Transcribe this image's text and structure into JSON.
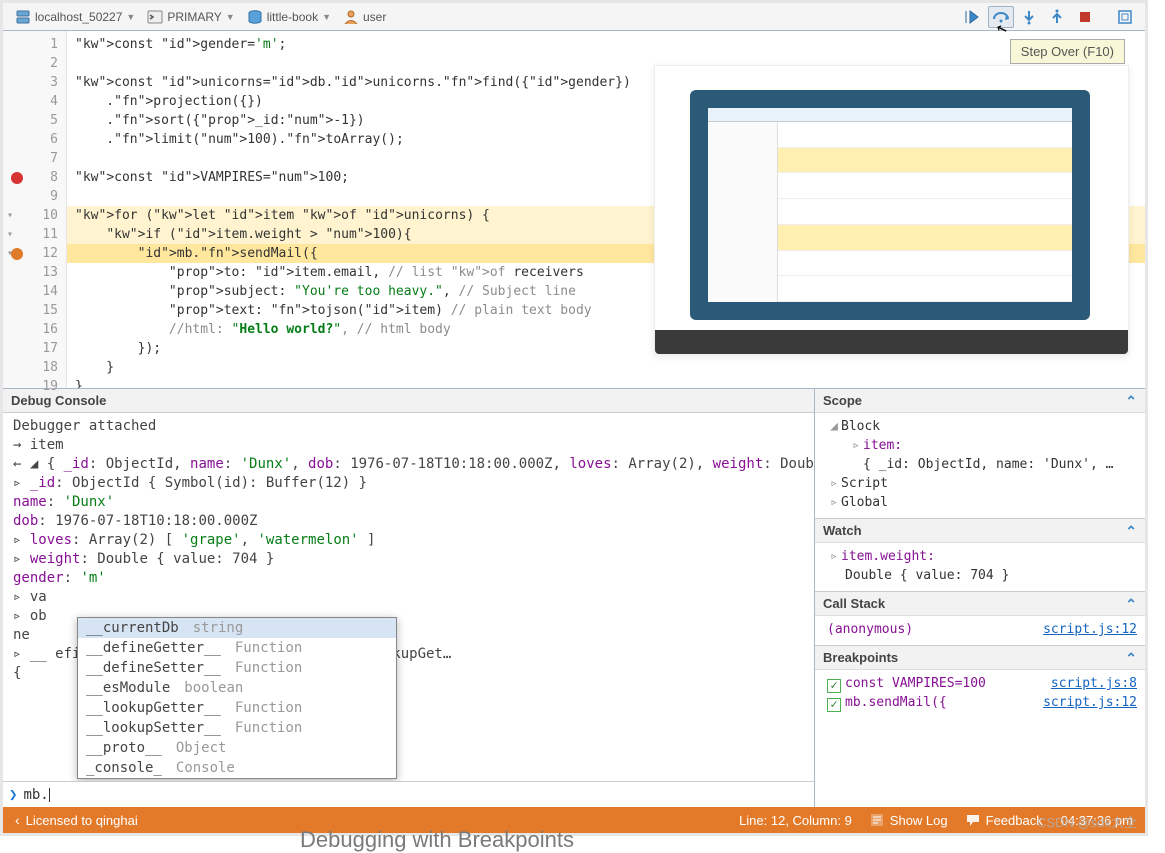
{
  "topbar": {
    "host": "localhost_50227",
    "role": "PRIMARY",
    "database": "little-book",
    "user": "user"
  },
  "tooltip": "Step Over (F10)",
  "code": {
    "lines": [
      {
        "n": 1,
        "txt": "const gender='m';",
        "stripe": true
      },
      {
        "n": 2,
        "txt": ""
      },
      {
        "n": 3,
        "txt": "const unicorns=db.unicorns.find({gender})",
        "stripe": true
      },
      {
        "n": 4,
        "txt": "    .projection({})"
      },
      {
        "n": 5,
        "txt": "    .sort({_id:-1})"
      },
      {
        "n": 6,
        "txt": "    .limit(100).toArray();",
        "stripe": true
      },
      {
        "n": 7,
        "txt": ""
      },
      {
        "n": 8,
        "txt": "const VAMPIRES=100;",
        "bp": true,
        "stripe": true
      },
      {
        "n": 9,
        "txt": ""
      },
      {
        "n": 10,
        "txt": "for (let item of unicorns) {",
        "hl": true,
        "fold": true,
        "stripe": true
      },
      {
        "n": 11,
        "txt": "    if (item.weight > 100){",
        "hl": true,
        "fold": true
      },
      {
        "n": 12,
        "txt": "        mb.sendMail({",
        "hlcur": true,
        "bpcur": true,
        "fold": true
      },
      {
        "n": 13,
        "txt": "            to: item.email, // list of receivers"
      },
      {
        "n": 14,
        "txt": "            subject: \"You're too heavy.\", // Subject line"
      },
      {
        "n": 15,
        "txt": "            text: tojson(item) // plain text body"
      },
      {
        "n": 16,
        "txt": "            //html: \"<b>Hello world?</b>\", // html body"
      },
      {
        "n": 17,
        "txt": "        });"
      },
      {
        "n": 18,
        "txt": "    }"
      },
      {
        "n": 19,
        "txt": "}"
      }
    ]
  },
  "debug_console": {
    "title": "Debug Console",
    "lines": [
      "   Debugger attached",
      "→  item",
      "← ◢ { _id: ObjectId, name: 'Dunx', dob: 1976-07-18T10:18:00.000Z, loves: Array(2), weight: Double, ... }",
      "  ▹ _id: ObjectId { Symbol(id): Buffer(12) }",
      "    name: 'Dunx'",
      "    dob: 1976-07-18T10:18:00.000Z",
      "  ▹ loves: Array(2) [ 'grape', 'watermelon' ]",
      "  ▹ weight: Double { value: 704 }",
      "    gender: 'm'",
      "  ▹ va",
      "  ▹ ob",
      "    ne",
      "  ▹ __                                       efineSetter__: , hasOwnProperty: , __lookupGet…",
      "    {"
    ],
    "prompt_value": "mb."
  },
  "autocomplete": [
    {
      "nm": "__currentDb",
      "ty": "string",
      "sel": true
    },
    {
      "nm": "__defineGetter__",
      "ty": "Function"
    },
    {
      "nm": "__defineSetter__",
      "ty": "Function"
    },
    {
      "nm": "__esModule",
      "ty": "boolean"
    },
    {
      "nm": "__lookupGetter__",
      "ty": "Function"
    },
    {
      "nm": "__lookupSetter__",
      "ty": "Function"
    },
    {
      "nm": "__proto__",
      "ty": "Object"
    },
    {
      "nm": "_console_",
      "ty": "Console"
    }
  ],
  "scope": {
    "title": "Scope",
    "block_label": "Block",
    "item_label": "item:",
    "item_val": "{ _id: ObjectId, name: 'Dunx', …",
    "script": "Script",
    "global": "Global"
  },
  "watch": {
    "title": "Watch",
    "expr": "item.weight:",
    "val": "Double { value: 704 }"
  },
  "callstack": {
    "title": "Call Stack",
    "frame": "(anonymous)",
    "loc": "script.js:12"
  },
  "breakpoints": {
    "title": "Breakpoints",
    "items": [
      {
        "label": "const VAMPIRES=100",
        "loc": "script.js:8"
      },
      {
        "label": "mb.sendMail({",
        "loc": "script.js:12"
      }
    ]
  },
  "status": {
    "license": "Licensed to qinghai",
    "pos": "Line: 12, Column: 9",
    "showlog": "Show Log",
    "feedback": "Feedback",
    "time": "04:37:36 pm"
  },
  "watermark": "CSDN @sdk大全",
  "subtitle": "Debugging with Breakpoints"
}
